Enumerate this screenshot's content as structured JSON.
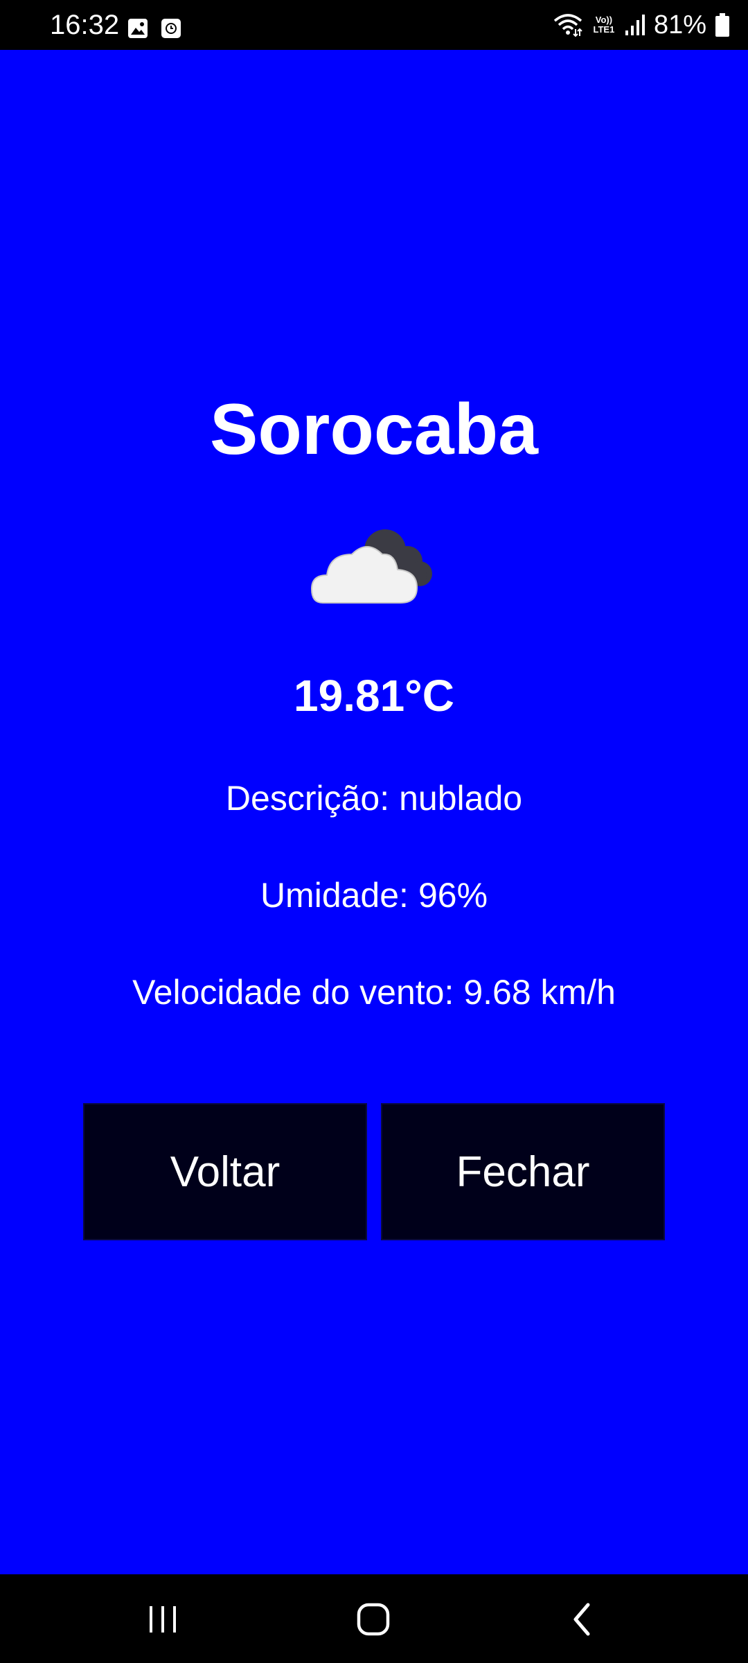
{
  "status_bar": {
    "time": "16:32",
    "battery_percent": "81%",
    "network_label_top": "Vo))",
    "network_label_bottom": "LTE1",
    "icons": [
      "gallery-icon",
      "clock-app-icon",
      "wifi-icon",
      "signal-icon",
      "battery-icon"
    ]
  },
  "weather": {
    "city": "Sorocaba",
    "icon": "cloudy-icon",
    "temperature": "19.81°C",
    "description_label": "Descrição:",
    "description_value": "nublado",
    "humidity_label": "Umidade:",
    "humidity_value": "96%",
    "wind_label": "Velocidade do vento:",
    "wind_value": "9.68 km/h"
  },
  "buttons": {
    "back_label": "Voltar",
    "close_label": "Fechar"
  },
  "colors": {
    "background": "#0000ff",
    "button_background": "#00001a",
    "text": "#ffffff"
  },
  "nav_bar": {
    "icons": [
      "recent-apps-icon",
      "home-icon",
      "back-icon"
    ]
  }
}
